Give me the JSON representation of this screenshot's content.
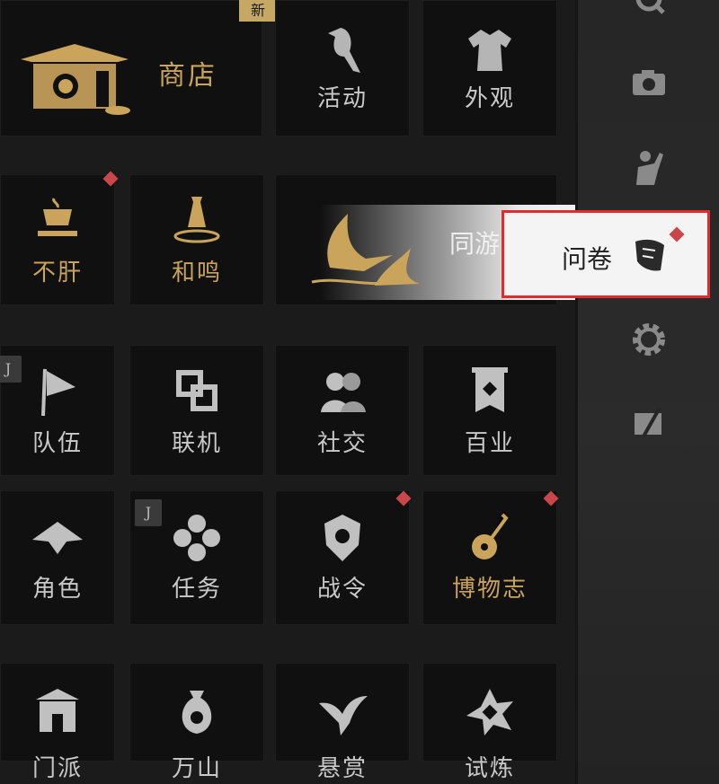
{
  "badge_new": "新",
  "row1": {
    "shop": "商店",
    "events": "活动",
    "appearance": "外观"
  },
  "row2": {
    "buganx": "不肝",
    "hemin": "和鸣",
    "tongyou": "同游"
  },
  "row3": {
    "team": "队伍",
    "online": "联机",
    "social": "社交",
    "baiye": "百业",
    "j_badge": "J"
  },
  "row4": {
    "role": "角色",
    "task": "任务",
    "battle": "战令",
    "museum": "博物志",
    "j_badge": "J"
  },
  "row5": {
    "a": "门派",
    "b": "万山",
    "c": "悬赏",
    "d": "试炼"
  },
  "popup": {
    "label": "问卷"
  },
  "colors": {
    "gold": "#c9a45a",
    "alert": "#c9474a",
    "highlight": "#e02c2c"
  },
  "sidebar_icons": [
    "magnifier-icon",
    "camera-icon",
    "character-icon",
    "settings-icon",
    "exit-icon"
  ]
}
